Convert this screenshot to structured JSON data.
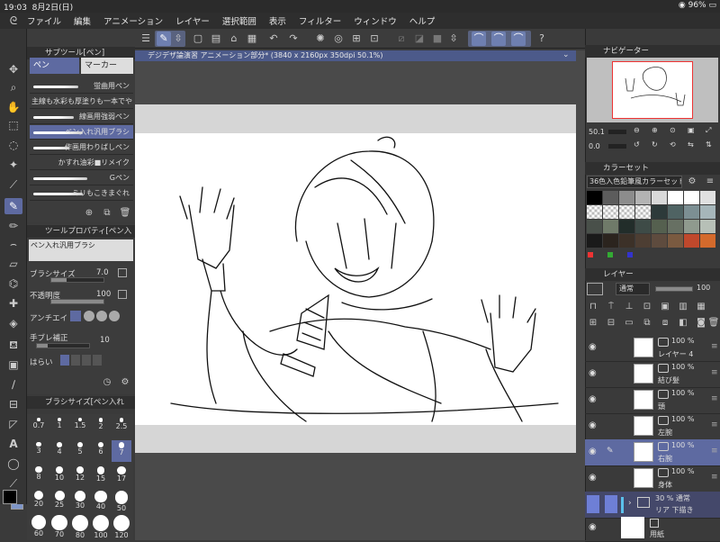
{
  "status": {
    "time": "19:03",
    "date": "8月2日(日)",
    "battery": "96%"
  },
  "menu": [
    "ファイル",
    "編集",
    "アニメーション",
    "レイヤー",
    "選択範囲",
    "表示",
    "フィルター",
    "ウィンドウ",
    "ヘルプ"
  ],
  "document_tab": "デジデザ論演習 アニメーション部分* (3840 x 2160px 350dpi 50.1%)",
  "subtool": {
    "header": "サブツール[ペン]",
    "tabs": [
      "ペン",
      "マーカー"
    ],
    "brushes": [
      "蛍曲用ペン",
      "主線も水彩も厚塗りも一本でや",
      "線画用強弱ペン",
      "ペン入れ汎用ブラシ",
      "作画用わりばしペン",
      "かすれ油彩■リメイク",
      "Gペン",
      "ミリもこきまぐれ"
    ]
  },
  "tool_property": {
    "header": "ツールプロパティ[ペン入",
    "brush_name": "ペン入れ汎用ブラシ",
    "brush_size_label": "ブラシサイズ",
    "brush_size": "7.0",
    "opacity_label": "不透明度",
    "opacity": "100",
    "antialias_label": "アンチエイ",
    "stabilization_label": "手ブレ補正",
    "stabilization": "10",
    "sweep_label": "はらい"
  },
  "brush_size_panel": {
    "header": "ブラシサイズ[ペン入れ",
    "sizes": [
      "0.7",
      "1",
      "1.5",
      "2",
      "2.5",
      "3",
      "4",
      "5",
      "6",
      "7",
      "8",
      "10",
      "12",
      "15",
      "17",
      "20",
      "25",
      "30",
      "40",
      "50",
      "60",
      "70",
      "80",
      "100",
      "120"
    ]
  },
  "navigator": {
    "header": "ナビゲーター",
    "zoom": "50.1",
    "rotation": "0.0"
  },
  "color_set": {
    "header": "カラーセット",
    "name": "36色入色鉛筆風カラーセット",
    "colors": [
      "#000000",
      "#5c5c5c",
      "#8c8c8c",
      "#b3b3b3",
      "#d9d9d9",
      "#ffffff",
      "#ffffff",
      "#e0e0e0",
      "checker",
      "checker",
      "checker",
      "checker",
      "#2d3a3a",
      "#4f6363",
      "#7c8f93",
      "#a6b6ba",
      "#49504a",
      "#6f7a69",
      "#222d2a",
      "#3e4b47",
      "#55604f",
      "#677063",
      "#8f9a8e",
      "#b7c0b7",
      "#1a1a1a",
      "#2b241e",
      "#3c3128",
      "#4d3e33",
      "#5e4b3e",
      "#7a5a40",
      "#c0482c",
      "#d46a2c"
    ]
  },
  "layers": {
    "header": "レイヤー",
    "blend_mode": "通常",
    "opacity": "100",
    "items": [
      {
        "pct": "100 %",
        "name": "レイヤー 4",
        "selected": false
      },
      {
        "pct": "100 %",
        "name": "結び髪",
        "selected": false
      },
      {
        "pct": "100 %",
        "name": "頭",
        "selected": false
      },
      {
        "pct": "100 %",
        "name": "左腕",
        "selected": false
      },
      {
        "pct": "100 %",
        "name": "右腕",
        "selected": true
      },
      {
        "pct": "100 %",
        "name": "身体",
        "selected": false
      }
    ],
    "folder": {
      "pct_mode": "30 % 通常",
      "name": "リア 下描き"
    },
    "paper": {
      "name": "用紙"
    }
  },
  "colors": {
    "accent": "#5e6aa1",
    "panel": "#3c3c3c",
    "header": "#2f2f2f"
  }
}
